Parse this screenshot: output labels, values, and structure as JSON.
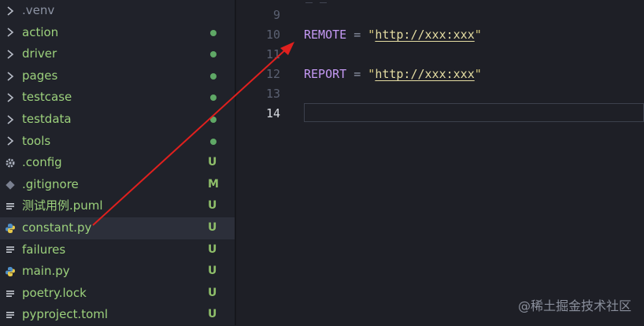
{
  "explorer": {
    "items": [
      {
        "label": ".venv",
        "icon": "chevron-right-icon",
        "status": "",
        "dim": true
      },
      {
        "label": "action",
        "icon": "chevron-right-icon",
        "status": "dot"
      },
      {
        "label": "driver",
        "icon": "chevron-right-icon",
        "status": "dot"
      },
      {
        "label": "pages",
        "icon": "chevron-right-icon",
        "status": "dot"
      },
      {
        "label": "testcase",
        "icon": "chevron-right-icon",
        "status": "dot"
      },
      {
        "label": "testdata",
        "icon": "chevron-right-icon",
        "status": "dot"
      },
      {
        "label": "tools",
        "icon": "chevron-right-icon",
        "status": "dot"
      },
      {
        "label": ".config",
        "icon": "gear-icon",
        "status": "U"
      },
      {
        "label": ".gitignore",
        "icon": "git-icon",
        "status": "M"
      },
      {
        "label": "测试用例.puml",
        "icon": "lines-icon",
        "status": "U"
      },
      {
        "label": "constant.py",
        "icon": "python-icon",
        "status": "U",
        "selected": true
      },
      {
        "label": "failures",
        "icon": "lines-icon",
        "status": "U"
      },
      {
        "label": "main.py",
        "icon": "python-icon",
        "status": "U"
      },
      {
        "label": "poetry.lock",
        "icon": "lines-icon",
        "status": "U"
      },
      {
        "label": "pyproject.toml",
        "icon": "lines-icon",
        "status": "U"
      }
    ]
  },
  "editor": {
    "lines": [
      {
        "num": "9",
        "var": "",
        "op": "",
        "str_open": "",
        "url": "",
        "str_close": ""
      },
      {
        "num": "10",
        "var": "REMOTE",
        "op": " = ",
        "str_open": "\"",
        "url": "http://xxx:xxx",
        "str_close": "\""
      },
      {
        "num": "11",
        "var": "",
        "op": "",
        "str_open": "",
        "url": "",
        "str_close": ""
      },
      {
        "num": "12",
        "var": "REPORT",
        "op": " = ",
        "str_open": "\"",
        "url": "http://xxx:xxx",
        "str_close": "\""
      },
      {
        "num": "13",
        "var": "",
        "op": "",
        "str_open": "",
        "url": "",
        "str_close": ""
      },
      {
        "num": "14",
        "var": "",
        "op": "",
        "str_open": "",
        "url": "",
        "str_close": "",
        "current": true
      }
    ]
  },
  "watermark": "@稀土掘金技术社区",
  "annotation_color": "#e0201e"
}
